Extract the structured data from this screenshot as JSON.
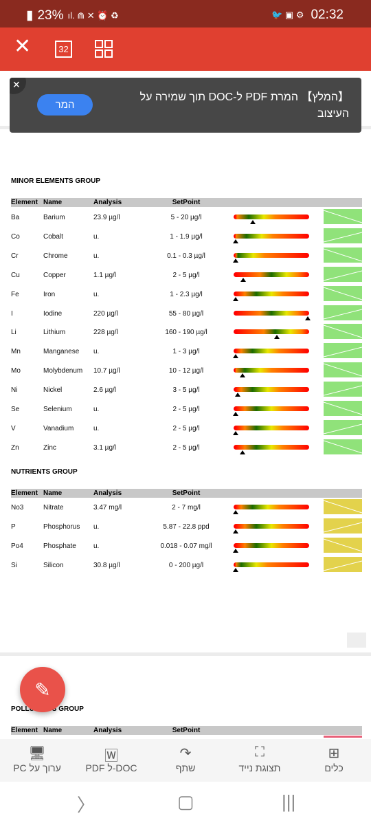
{
  "status_bar": {
    "battery": "23%",
    "time": "02:32"
  },
  "toolbar": {
    "page_count": "32"
  },
  "toast": {
    "message": "【המלץ】 המרת PDF ל-DOC תוך שמירה על העיצוב",
    "button": "המר"
  },
  "table_headers": {
    "element": "Element",
    "name": "Name",
    "analysis": "Analysis",
    "setpoint": "SetPoint"
  },
  "colors": {
    "ok": "#90e27a",
    "warn": "#e3d24c",
    "pollutant": "#e86078",
    "toolbar": "#e04030"
  },
  "groups": [
    {
      "title": "MINOR ELEMENTS GROUP",
      "status": "ok",
      "rows": [
        {
          "element": "Ba",
          "name": "Barium",
          "analysis": "23.9 µg/l",
          "setpoint": "5 - 20 µg/l",
          "marker": 0.25,
          "green_at": 0.2
        },
        {
          "element": "Co",
          "name": "Cobalt",
          "analysis": "u.",
          "setpoint": "1 - 1.9 µg/l",
          "marker": 0.03,
          "green_at": 0.17
        },
        {
          "element": "Cr",
          "name": "Chrome",
          "analysis": "u.",
          "setpoint": "0.1 - 0.3 µg/l",
          "marker": 0.03,
          "green_at": 0.06
        },
        {
          "element": "Cu",
          "name": "Copper",
          "analysis": "1.1 µg/l",
          "setpoint": "2 - 5 µg/l",
          "marker": 0.13,
          "green_at": 0.5
        },
        {
          "element": "Fe",
          "name": "Iron",
          "analysis": "u.",
          "setpoint": "1 - 2.3 µg/l",
          "marker": 0.03,
          "green_at": 0.3
        },
        {
          "element": "I",
          "name": "Iodine",
          "analysis": "220 µg/l",
          "setpoint": "55 - 80 µg/l",
          "marker": 0.98,
          "green_at": 0.5
        },
        {
          "element": "Li",
          "name": "Lithium",
          "analysis": "228 µg/l",
          "setpoint": "160 - 190 µg/l",
          "marker": 0.57,
          "green_at": 0.55
        },
        {
          "element": "Mn",
          "name": "Manganese",
          "analysis": "u.",
          "setpoint": "1 - 3 µg/l",
          "marker": 0.03,
          "green_at": 0.25
        },
        {
          "element": "Mo",
          "name": "Molybdenum",
          "analysis": "10.7 µg/l",
          "setpoint": "10 - 12 µg/l",
          "marker": 0.12,
          "green_at": 0.15
        },
        {
          "element": "Ni",
          "name": "Nickel",
          "analysis": "2.6 µg/l",
          "setpoint": "3 - 5 µg/l",
          "marker": 0.05,
          "green_at": 0.25
        },
        {
          "element": "Se",
          "name": "Selenium",
          "analysis": "u.",
          "setpoint": "2 - 5 µg/l",
          "marker": 0.03,
          "green_at": 0.3
        },
        {
          "element": "V",
          "name": "Vanadium",
          "analysis": "u.",
          "setpoint": "2 - 5 µg/l",
          "marker": 0.03,
          "green_at": 0.3
        },
        {
          "element": "Zn",
          "name": "Zinc",
          "analysis": "3.1 µg/l",
          "setpoint": "2 - 5 µg/l",
          "marker": 0.12,
          "green_at": 0.3
        }
      ]
    },
    {
      "title": "NUTRIENTS GROUP",
      "status": "warn",
      "rows": [
        {
          "element": "No3",
          "name": "Nitrate",
          "analysis": "3.47 mg/l",
          "setpoint": "2 - 7 mg/l",
          "marker": 0.03,
          "green_at": 0.25
        },
        {
          "element": "P",
          "name": "Phosphorus",
          "analysis": "u.",
          "setpoint": "5.87 - 22.8 ppd",
          "marker": 0.03,
          "green_at": 0.3
        },
        {
          "element": "Po4",
          "name": "Phosphate",
          "analysis": "u.",
          "setpoint": "0.018 - 0.07 mg/l",
          "marker": 0.03,
          "green_at": 0.3
        },
        {
          "element": "Si",
          "name": "Silicon",
          "analysis": "30.8 µg/l",
          "setpoint": "0 - 200 µg/l",
          "marker": 0.03,
          "green_at": 0.1
        }
      ]
    },
    {
      "title": "POLLUTANTS GROUP",
      "status": "pollutant",
      "rows": []
    }
  ],
  "bottom_bar": [
    {
      "label": "כלים",
      "icon": "tools-icon"
    },
    {
      "label": "תצוגת נייד",
      "icon": "mobile-view-icon"
    },
    {
      "label": "שתף",
      "icon": "share-icon"
    },
    {
      "label": "DOC-ל PDF",
      "icon": "word-icon"
    },
    {
      "label": "ערוך על PC",
      "icon": "pc-icon"
    }
  ]
}
